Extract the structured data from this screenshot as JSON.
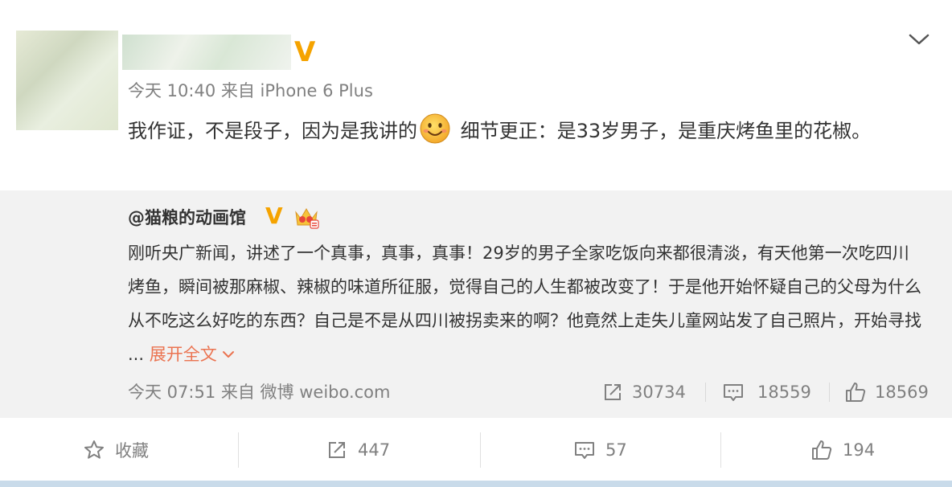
{
  "post": {
    "meta": "今天 10:40 来自 iPhone 6 Plus",
    "text_before_emoji": "我作证，不是段子，因为是我讲的",
    "text_after_emoji": " 细节更正：是33岁男子，是重庆烤鱼里的花椒。",
    "verified_badge": "V",
    "emoji_icon": "smile-emoji-icon"
  },
  "repost": {
    "author": "@猫粮的动画馆",
    "verified_badge": "V",
    "text": "刚听央广新闻，讲述了一个真事，真事，真事！29岁的男子全家吃饭向来都很清淡，有天他第一次吃四川烤鱼，瞬间被那麻椒、辣椒的味道所征服，觉得自己的人生都被改变了！于是他开始怀疑自己的父母为什么从不吃这么好吃的东西？自己是不是从四川被拐卖来的啊？他竟然上走失儿童网站发了自己照片，开始寻找 ... ",
    "expand_label": "展开全文",
    "meta": "今天 07:51 来自 微博 weibo.com",
    "reposts": "30734",
    "comments": "18559",
    "likes": "18569"
  },
  "actions": {
    "favorite_label": "收藏",
    "repost_count": "447",
    "comment_count": "57",
    "like_count": "194"
  },
  "colors": {
    "accent": "#eb7350",
    "verified": "#f5a300",
    "muted": "#808080",
    "repost_bg": "#f2f2f2"
  }
}
